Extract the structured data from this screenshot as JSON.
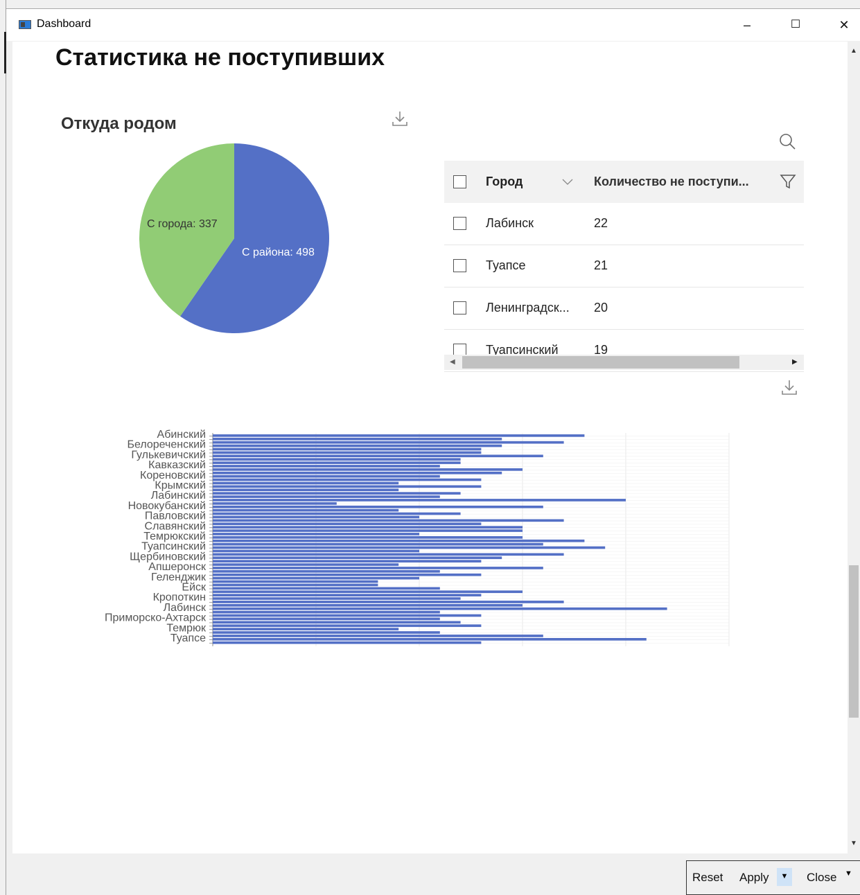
{
  "window": {
    "title": "Dashboard",
    "minimize": "–",
    "maximize": "☐",
    "close": "✕"
  },
  "page": {
    "title": "Статистика не поступивших"
  },
  "pie": {
    "title": "Откуда родом",
    "label_district": "С района: 498",
    "label_city": "С города: 337",
    "colors": {
      "district": "#5470c6",
      "city": "#91cc75"
    }
  },
  "chart_data": [
    {
      "type": "pie",
      "title": "Откуда родом",
      "slices": [
        {
          "label": "С района",
          "value": 498,
          "color": "#5470c6"
        },
        {
          "label": "С города",
          "value": 337,
          "color": "#91cc75"
        }
      ]
    },
    {
      "type": "bar",
      "orientation": "horizontal",
      "color": "#5470c6",
      "category_labels_shown": [
        "Абинский",
        "Белореченский",
        "Гулькевичский",
        "Кавказский",
        "Кореновский",
        "Крымский",
        "Лабинский",
        "Новокубанский",
        "Павловский",
        "Славянский",
        "Темрюкский",
        "Туапсинский",
        "Щербиновский",
        "Апшеронск",
        "Геленджик",
        "Ейск",
        "Кропоткин",
        "Лабинск",
        "Приморско-Ахтарск",
        "Темрюк",
        "Туапсе"
      ],
      "values": [
        18,
        14,
        17,
        14,
        13,
        13,
        16,
        12,
        12,
        11,
        15,
        14,
        11,
        13,
        9,
        13,
        9,
        12,
        11,
        20,
        6,
        16,
        9,
        12,
        10,
        17,
        13,
        15,
        15,
        10,
        15,
        18,
        16,
        19,
        10,
        17,
        14,
        13,
        9,
        16,
        11,
        13,
        10,
        8,
        8,
        11,
        15,
        13,
        12,
        17,
        15,
        22,
        11,
        13,
        11,
        12,
        13,
        9,
        11,
        16,
        21,
        13
      ],
      "grid": true
    }
  ],
  "grid": {
    "col_city": "Город",
    "col_count": "Количество не поступи...",
    "rows": [
      {
        "city": "Лабинск",
        "count": "22"
      },
      {
        "city": "Туапсе",
        "count": "21"
      },
      {
        "city": "Ленинградск...",
        "count": "20"
      },
      {
        "city": "Туапсинский",
        "count": "19"
      }
    ]
  },
  "footer": {
    "reset": "Reset",
    "apply": "Apply",
    "close": "Close"
  }
}
